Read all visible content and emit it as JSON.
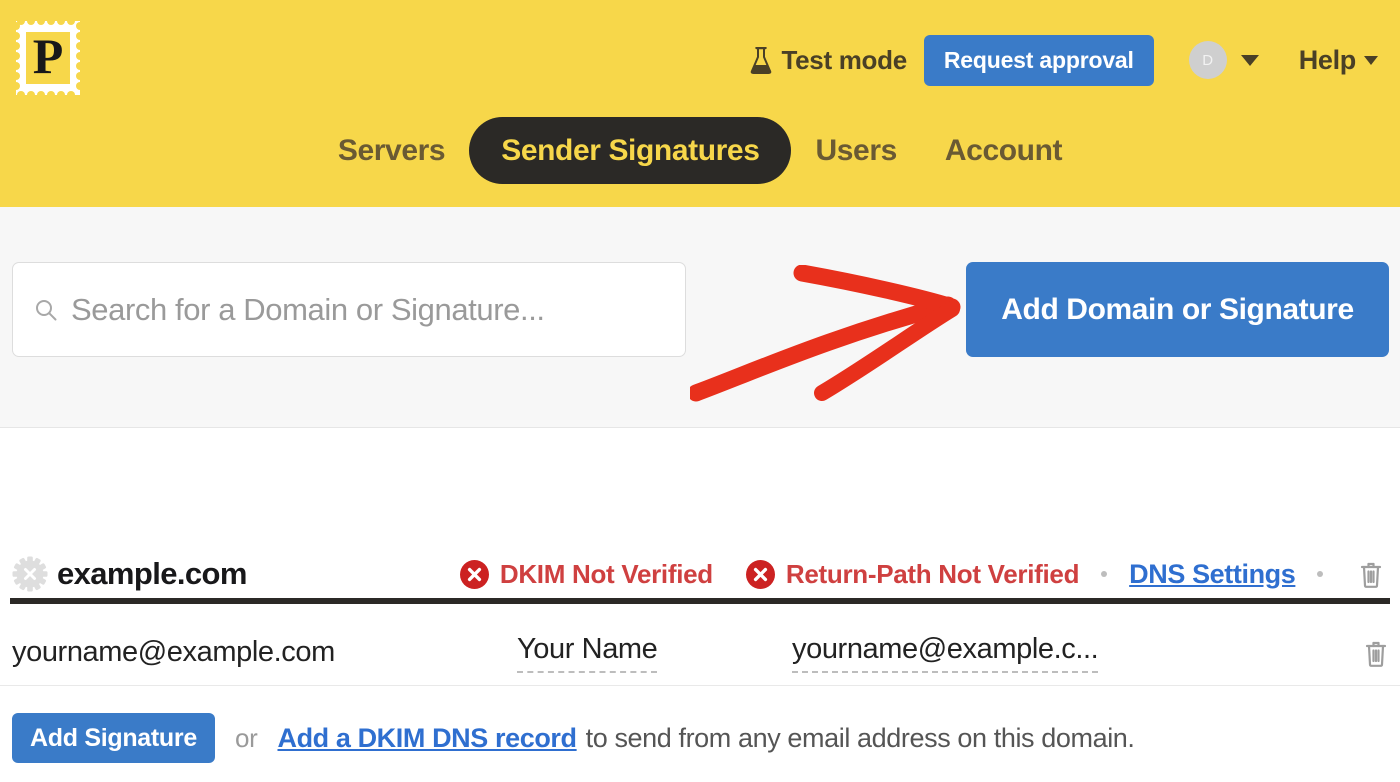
{
  "brand": {
    "logo_letter": "P",
    "logo_name": "postmark-stamp-logo",
    "header_bg": "#f7d74a",
    "accent_blue": "#3a7bc8",
    "link_blue": "#2f6fd0",
    "error_red": "#cf4040",
    "dark": "#2b2926"
  },
  "header": {
    "test_mode_label": "Test mode",
    "test_mode_icon": "flask-icon",
    "request_approval_label": "Request approval",
    "avatar_initial": "D",
    "avatar_caret_icon": "chevron-down-icon",
    "help_label": "Help",
    "help_caret_icon": "chevron-down-icon"
  },
  "nav": {
    "items": [
      {
        "label": "Servers",
        "active": false
      },
      {
        "label": "Sender Signatures",
        "active": true
      },
      {
        "label": "Users",
        "active": false
      },
      {
        "label": "Account",
        "active": false
      }
    ]
  },
  "toolbar": {
    "search_placeholder": "Search for a Domain or Signature...",
    "search_value": "",
    "search_icon": "search-icon",
    "add_domain_label": "Add Domain or Signature",
    "annotation": "red-arrow pointing at Add Domain or Signature button"
  },
  "domain": {
    "badge_icon": "starburst-x-icon",
    "name": "example.com",
    "statuses": [
      {
        "icon": "x-circle-icon",
        "label": "DKIM Not Verified"
      },
      {
        "icon": "x-circle-icon",
        "label": "Return-Path Not Verified"
      }
    ],
    "dns_settings_label": "DNS Settings",
    "delete_icon": "trash-icon"
  },
  "signatures": {
    "columns": [
      "email",
      "name",
      "reply_to"
    ],
    "rows": [
      {
        "email": "yourname@example.com",
        "name": "Your Name",
        "reply_to": "yourname@example.c...",
        "delete_icon": "trash-icon"
      }
    ]
  },
  "footer": {
    "add_signature_label": "Add Signature",
    "or_label": "or",
    "dkim_link_label": "Add a DKIM DNS record",
    "tail_text": "to send from any email address on this domain."
  }
}
